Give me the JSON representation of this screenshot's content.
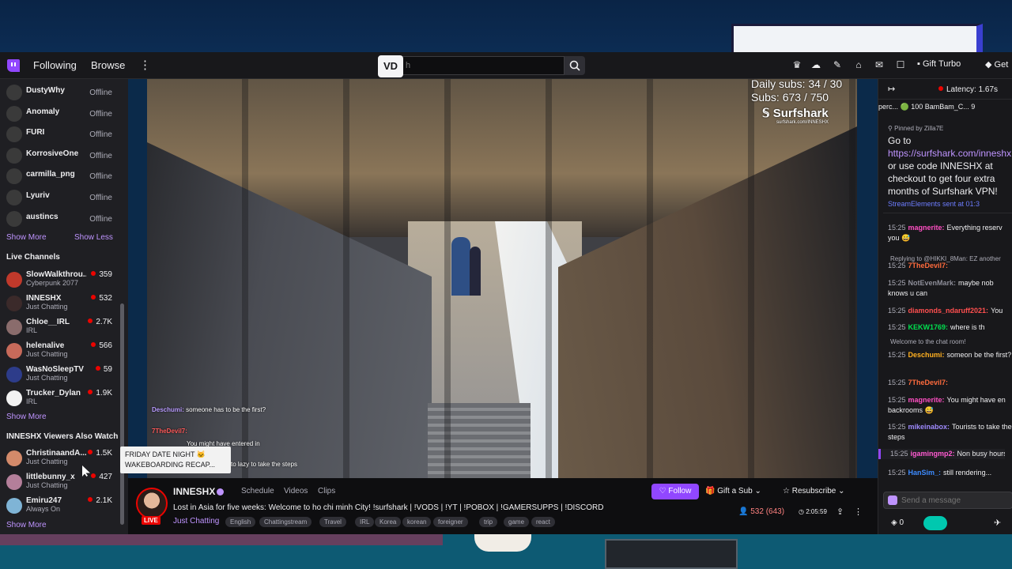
{
  "topbar": {
    "following": "Following",
    "browse": "Browse",
    "search_placeholder": "h",
    "vd_badge": "VD",
    "gift_turbo": "Gift Turbo",
    "get": "Get"
  },
  "sidebar": {
    "followed": [
      {
        "name": "DustyWhy",
        "status": "Offline"
      },
      {
        "name": "Anomaly",
        "status": "Offline"
      },
      {
        "name": "FURI",
        "status": "Offline"
      },
      {
        "name": "KorrosiveOne",
        "status": "Offline"
      },
      {
        "name": "carmilla_png",
        "status": "Offline"
      },
      {
        "name": "Lyuriv",
        "status": "Offline"
      },
      {
        "name": "austincs",
        "status": "Offline"
      }
    ],
    "show_more": "Show More",
    "show_less": "Show Less",
    "live_heading": "Live Channels",
    "live": [
      {
        "name": "SlowWalkthrou...",
        "game": "Cyberpunk 2077",
        "viewers": "359",
        "color": "#c0392b"
      },
      {
        "name": "INNESHX",
        "game": "Just Chatting",
        "viewers": "532",
        "color": "#3b2a2a"
      },
      {
        "name": "Chloe__IRL",
        "game": "IRL",
        "viewers": "2.7K",
        "color": "#8a6c6c"
      },
      {
        "name": "helenalive",
        "game": "Just Chatting",
        "viewers": "566",
        "color": "#c76a5a"
      },
      {
        "name": "WasNoSleepTV",
        "game": "Just Chatting",
        "viewers": "59",
        "color": "#2d3c8a"
      },
      {
        "name": "Trucker_Dylan",
        "game": "IRL",
        "viewers": "1.9K",
        "color": "#f2f2f2"
      }
    ],
    "live_show_more": "Show More",
    "also_watch_heading": "INNESHX Viewers Also Watch",
    "also_watch": [
      {
        "name": "ChristinaandA...",
        "game": "Just Chatting",
        "viewers": "1.5K",
        "color": "#d38a6a"
      },
      {
        "name": "littlebunny_x",
        "game": "Just Chatting",
        "viewers": "427",
        "color": "#b47f9a"
      },
      {
        "name": "Emiru247",
        "game": "Always On",
        "viewers": "2.1K",
        "color": "#7fb4d6"
      }
    ],
    "also_show_more": "Show More",
    "tooltip_line1": "FRIDAY DATE NIGHT 🐱",
    "tooltip_line2": "WAKEBOARDING RECAP..."
  },
  "video": {
    "daily_subs": "Daily subs: 34 / 30",
    "subs": "Subs: 673 / 750",
    "sponsor": "Surfshark",
    "sponsor_url": "surfshark.com/INNESHX",
    "overlay_chat": [
      {
        "user": "Deschumi:",
        "text": "someone has to be the first?"
      },
      {
        "user": "7TheDevil7:",
        "text": ""
      },
      {
        "user": "",
        "text": "You might have entered in"
      },
      {
        "user": "",
        "text": "to lazy to take the steps"
      }
    ]
  },
  "info": {
    "streamer": "INNESHX",
    "tabs": [
      "Schedule",
      "Videos",
      "Clips"
    ],
    "live": "LIVE",
    "title": "Lost in Asia for five weeks: Welcome to ho chi minh City! !surfshark | !VODS | !YT | !POBOX | !GAMERSUPPS | !DISCORD",
    "category": "Just Chatting",
    "tags": [
      "English",
      "Chattingstream",
      "Travel",
      "IRL",
      "Korea",
      "korean",
      "foreigner",
      "trip",
      "game",
      "react"
    ],
    "follow": "Follow",
    "gift": "Gift a Sub",
    "resubscribe": "Resubscribe",
    "viewers": "532 (643)",
    "uptime": "2:05:59"
  },
  "chat": {
    "latency": "Latency: 1.67s",
    "leaderboard": "perc... 🟢 100  BamBam_C... 9",
    "pinned_by": "Pinned by Zilla7E",
    "pinned_pre": "Go to ",
    "pinned_link": "https://surfshark.com/inneshx",
    "pinned_post": " or use code INNESHX at checkout to get four extra months of Surfshark VPN!",
    "pinned_sender": "StreamElements sent at 01:3",
    "messages": [
      {
        "time": "15:25",
        "user": "magnerite:",
        "text": "Everything reserv you 😅",
        "color": "#ff4fc3"
      },
      {
        "time": "",
        "user": "",
        "text": "Replying to @HIKKI_8Man: EZ another",
        "color": "#adadb8"
      },
      {
        "time": "15:25",
        "user": "7TheDevil7:",
        "text": "",
        "color": "#ff6b3d"
      },
      {
        "time": "15:25",
        "user": "NotEvenMark:",
        "text": "maybe nob knows u can",
        "color": "#8e8e99"
      },
      {
        "time": "15:25",
        "user": "diamonds_ndaruff2021:",
        "text": "You",
        "color": "#ff4f4f"
      },
      {
        "time": "15:25",
        "user": "KEKW1769:",
        "text": "where is th",
        "color": "#00e14f"
      },
      {
        "time": "",
        "user": "",
        "text": "Welcome to the chat room!",
        "color": "#adadb8"
      },
      {
        "time": "15:25",
        "user": "Deschumi:",
        "text": "someon be the first?",
        "color": "#ffb020"
      },
      {
        "time": "15:25",
        "user": "7TheDevil7:",
        "text": "",
        "color": "#ff6b3d"
      },
      {
        "time": "15:25",
        "user": "magnerite:",
        "text": "You might have en backrooms 😅",
        "color": "#ff4fc3"
      },
      {
        "time": "15:25",
        "user": "mikeinabox:",
        "text": "Tourists to take the steps",
        "color": "#9f8bff"
      },
      {
        "time": "15:25",
        "user": "igamingmp2:",
        "text": "Non busy hours",
        "color": "#ff5ad1"
      },
      {
        "time": "15:25",
        "user": "HanSim_:",
        "text": "still rendering...",
        "color": "#3d8bff"
      }
    ],
    "input_placeholder": "Send a message",
    "points": "0"
  }
}
